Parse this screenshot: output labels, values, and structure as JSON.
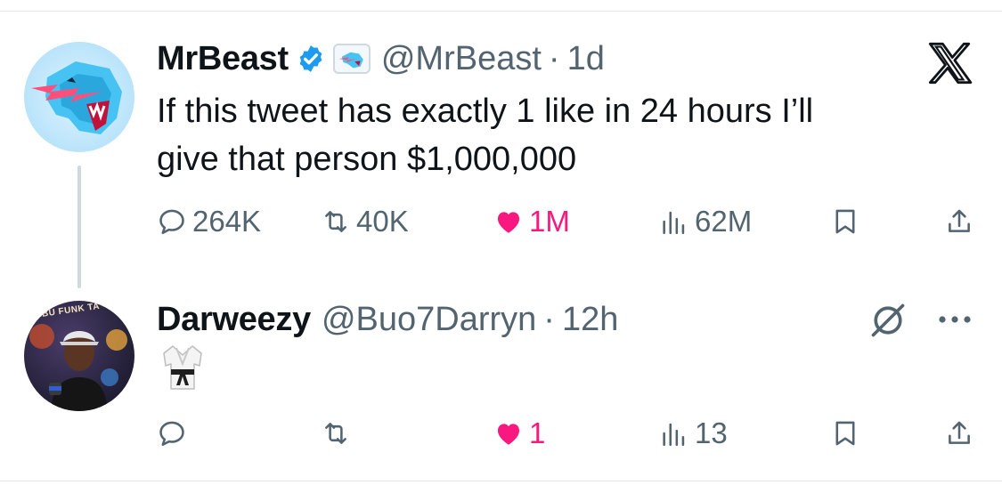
{
  "tweets": [
    {
      "name": "MrBeast",
      "handle": "@MrBeast",
      "separator": "·",
      "time": "1d",
      "verified": true,
      "text_line1": "If this tweet has exactly 1 like in 24 hours I’ll",
      "text_line2": "give that person $1,000,000",
      "replies": "264K",
      "reposts": "40K",
      "likes": "1M",
      "views": "62M",
      "liked": true
    },
    {
      "name": "Darweezy",
      "handle": "@Buo7Darryn",
      "separator": "·",
      "time": "12h",
      "emoji": "🥋",
      "replies": "",
      "reposts": "",
      "likes": "1",
      "views": "13",
      "liked": true
    }
  ],
  "avatar2_banner_text": "LIBU FUNK TA",
  "colors": {
    "like": "#f91880",
    "verified": "#1d9bf0",
    "muted": "#536471",
    "thread_line": "#cfd9de"
  },
  "icons": [
    "reply-icon",
    "repost-icon",
    "heart-icon",
    "views-icon",
    "bookmark-icon",
    "share-icon",
    "x-logo-icon",
    "mute-conversation-icon",
    "more-icon",
    "verified-badge-icon"
  ]
}
